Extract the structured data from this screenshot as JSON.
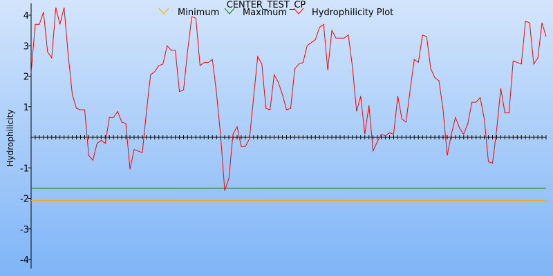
{
  "chart_data": {
    "type": "line",
    "title": "CENTER_TEST_CP",
    "ylabel": "Hydrophilicity",
    "xlabel": "",
    "ylim": [
      -4.3,
      4.3
    ],
    "y_ticks": [
      "4",
      "3",
      "2",
      "1",
      "-1",
      "-2",
      "-3",
      "-4"
    ],
    "y_tick_values": [
      4,
      3,
      2,
      1,
      -1,
      -2,
      -3,
      -4
    ],
    "legend_position": "top",
    "series": [
      {
        "name": "Minimum",
        "color": "#ffa500",
        "values": [
          -2.07
        ]
      },
      {
        "name": "Maximum",
        "color": "#008000",
        "values": [
          -1.67
        ]
      },
      {
        "name": "Hydrophilicity Plot",
        "color": "#ff0000",
        "values": [
          2.1,
          3.7,
          3.7,
          4.1,
          2.8,
          2.6,
          4.25,
          3.7,
          4.25,
          2.7,
          1.4,
          0.95,
          0.9,
          0.9,
          -0.6,
          -0.75,
          -0.2,
          -0.1,
          -0.2,
          0.65,
          0.65,
          0.85,
          0.5,
          0.45,
          -1.05,
          -0.4,
          -0.45,
          -0.5,
          0.85,
          2.05,
          2.15,
          2.35,
          2.4,
          3.0,
          2.85,
          2.85,
          1.5,
          1.55,
          2.85,
          3.95,
          3.9,
          2.35,
          2.45,
          2.45,
          2.55,
          1.45,
          0.05,
          -1.75,
          -1.35,
          0.1,
          0.35,
          -0.3,
          -0.3,
          -0.05,
          1.3,
          2.65,
          2.4,
          0.95,
          0.9,
          2.05,
          1.8,
          1.4,
          0.9,
          0.95,
          2.25,
          2.4,
          2.45,
          3.0,
          3.1,
          3.2,
          3.6,
          3.7,
          2.2,
          3.5,
          3.25,
          3.25,
          3.25,
          3.35,
          2.3,
          0.85,
          1.35,
          0.1,
          1.05,
          -0.45,
          -0.15,
          0.1,
          0.05,
          0.15,
          0.1,
          1.35,
          0.6,
          0.5,
          1.55,
          2.55,
          2.45,
          3.35,
          3.3,
          2.25,
          1.95,
          1.85,
          0.9,
          -0.6,
          0.1,
          0.65,
          0.3,
          0.1,
          0.45,
          1.15,
          1.15,
          1.3,
          0.6,
          -0.8,
          -0.85,
          0.25,
          1.6,
          0.8,
          0.8,
          2.5,
          2.45,
          2.4,
          3.8,
          3.75,
          2.4,
          2.6,
          3.75,
          3.3
        ]
      }
    ],
    "zero_line_color": "#000000",
    "grid": false
  }
}
